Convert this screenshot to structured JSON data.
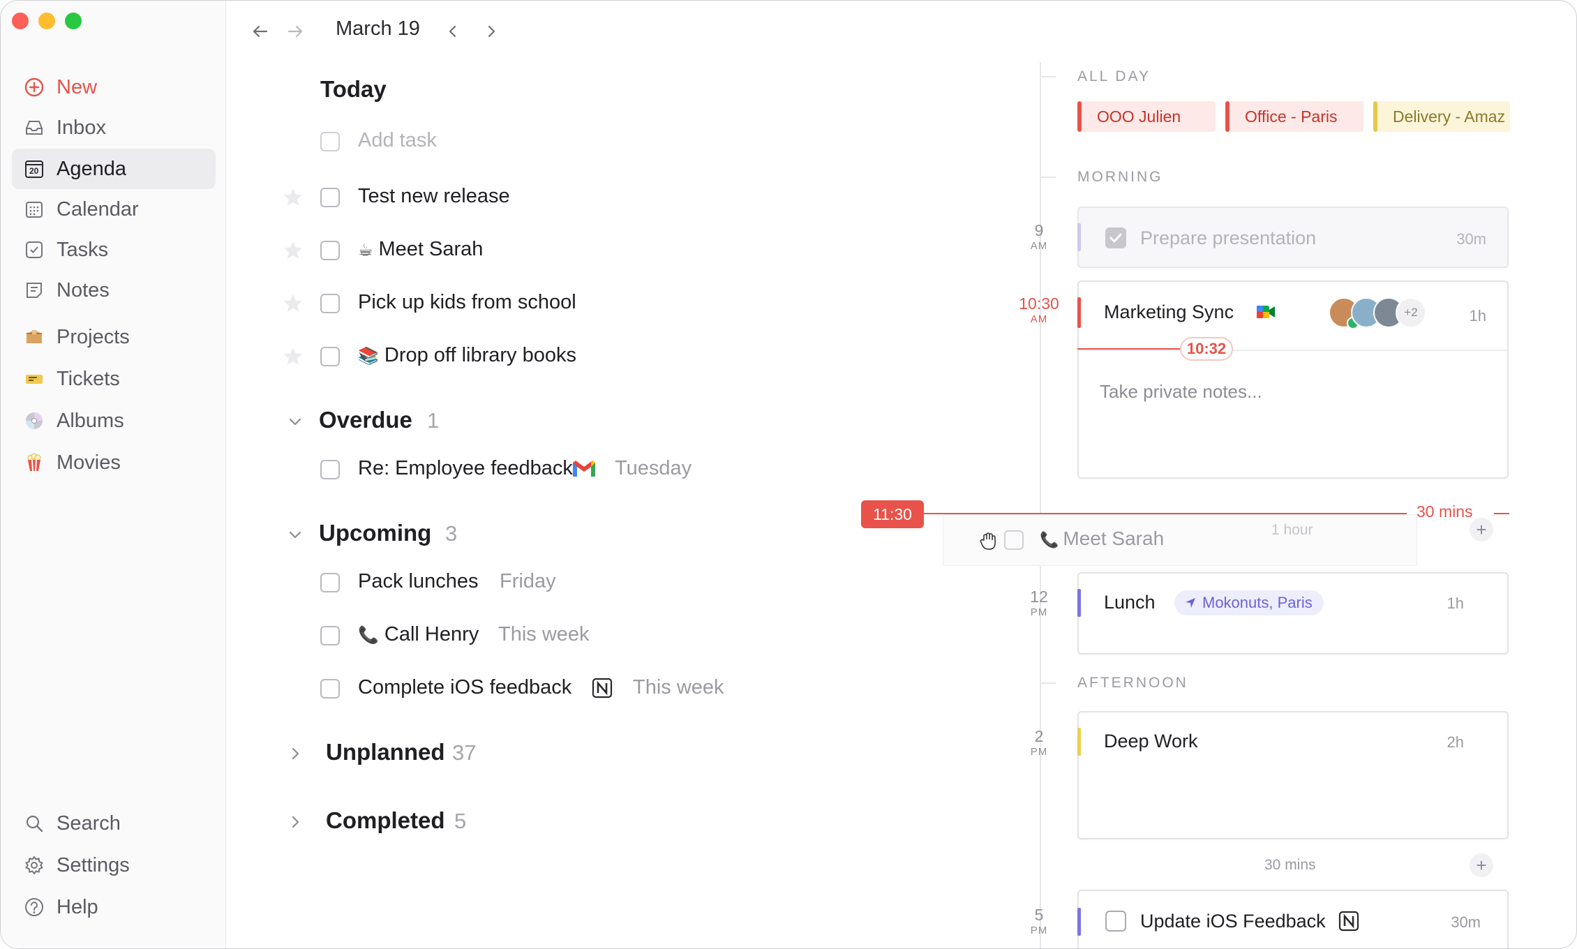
{
  "header": {
    "date": "March 19"
  },
  "sidebar": {
    "new_label": "New",
    "items": [
      {
        "label": "Inbox",
        "icon": "inbox-icon"
      },
      {
        "label": "Agenda",
        "icon": "agenda-icon",
        "badge": "20",
        "active": true
      },
      {
        "label": "Calendar",
        "icon": "calendar-icon"
      },
      {
        "label": "Tasks",
        "icon": "tasks-icon"
      },
      {
        "label": "Notes",
        "icon": "notes-icon"
      },
      {
        "label": "Projects",
        "icon": "box-icon"
      },
      {
        "label": "Tickets",
        "icon": "ticket-icon"
      },
      {
        "label": "Albums",
        "icon": "disc-icon"
      },
      {
        "label": "Movies",
        "icon": "popcorn-icon"
      }
    ],
    "footer": [
      {
        "label": "Search",
        "icon": "search-icon"
      },
      {
        "label": "Settings",
        "icon": "gear-icon"
      },
      {
        "label": "Help",
        "icon": "help-icon"
      }
    ]
  },
  "tasks": {
    "today": {
      "title": "Today",
      "add_placeholder": "Add task",
      "items": [
        {
          "emoji": "",
          "text": "Test new release"
        },
        {
          "emoji": "☕",
          "text": "Meet Sarah"
        },
        {
          "emoji": "",
          "text": "Pick up kids from school"
        },
        {
          "emoji": "📚",
          "text": "Drop off library books"
        }
      ]
    },
    "overdue": {
      "title": "Overdue",
      "count": "1",
      "items": [
        {
          "text": "Re: Employee feedback",
          "source": "gmail-icon",
          "when": "Tuesday"
        }
      ]
    },
    "upcoming": {
      "title": "Upcoming",
      "count": "3",
      "items": [
        {
          "emoji": "",
          "text": "Pack lunches",
          "when": "Friday"
        },
        {
          "emoji": "📞",
          "text": "Call Henry",
          "when": "This week"
        },
        {
          "emoji": "",
          "text": "Complete iOS feedback",
          "source": "notion-icon",
          "when": "This week"
        }
      ]
    },
    "unplanned": {
      "title": "Unplanned",
      "count": "37"
    },
    "completed": {
      "title": "Completed",
      "count": "5"
    }
  },
  "timeline": {
    "all_day_label": "ALL DAY",
    "all_day": [
      {
        "label": "OOO Julien",
        "color": "#e8524a",
        "bg": "#fde9e7",
        "text": "#c8322a"
      },
      {
        "label": "Office - Paris",
        "color": "#e8524a",
        "bg": "#fde9e7",
        "text": "#c8322a"
      },
      {
        "label": "Delivery - Amaz",
        "color": "#e6c84a",
        "bg": "#fcf5da",
        "text": "#8a7a2a"
      }
    ],
    "morning_label": "MORNING",
    "afternoon_label": "AFTERNOON",
    "hours": [
      {
        "h": "9",
        "ap": "AM"
      },
      {
        "h": "10:30",
        "ap": "AM",
        "current": true
      },
      {
        "h": "12",
        "ap": "PM"
      },
      {
        "h": "2",
        "ap": "PM"
      },
      {
        "h": "5",
        "ap": "PM"
      }
    ],
    "events": {
      "prepare": {
        "title": "Prepare presentation",
        "duration": "30m",
        "done": true,
        "color": "#cdc8f0"
      },
      "marketing": {
        "title": "Marketing Sync",
        "duration": "1h",
        "extra_attendees": "+2",
        "now": "10:32",
        "notes_placeholder": "Take private notes...",
        "color": "#e8524a"
      },
      "lunch": {
        "title": "Lunch",
        "location": "Mokonuts, Paris",
        "duration": "1h",
        "color": "#7b74e6"
      },
      "deep": {
        "title": "Deep Work",
        "duration": "2h",
        "color": "#ecd04f"
      },
      "ios": {
        "title": "Update iOS Feedback",
        "duration": "30m",
        "color": "#7b74e6"
      }
    },
    "drag": {
      "time": "11:30",
      "gap": "30 mins",
      "ghost_title": "Meet Sarah",
      "ghost_duration": "1 hour"
    },
    "gap_label": "30 mins"
  }
}
